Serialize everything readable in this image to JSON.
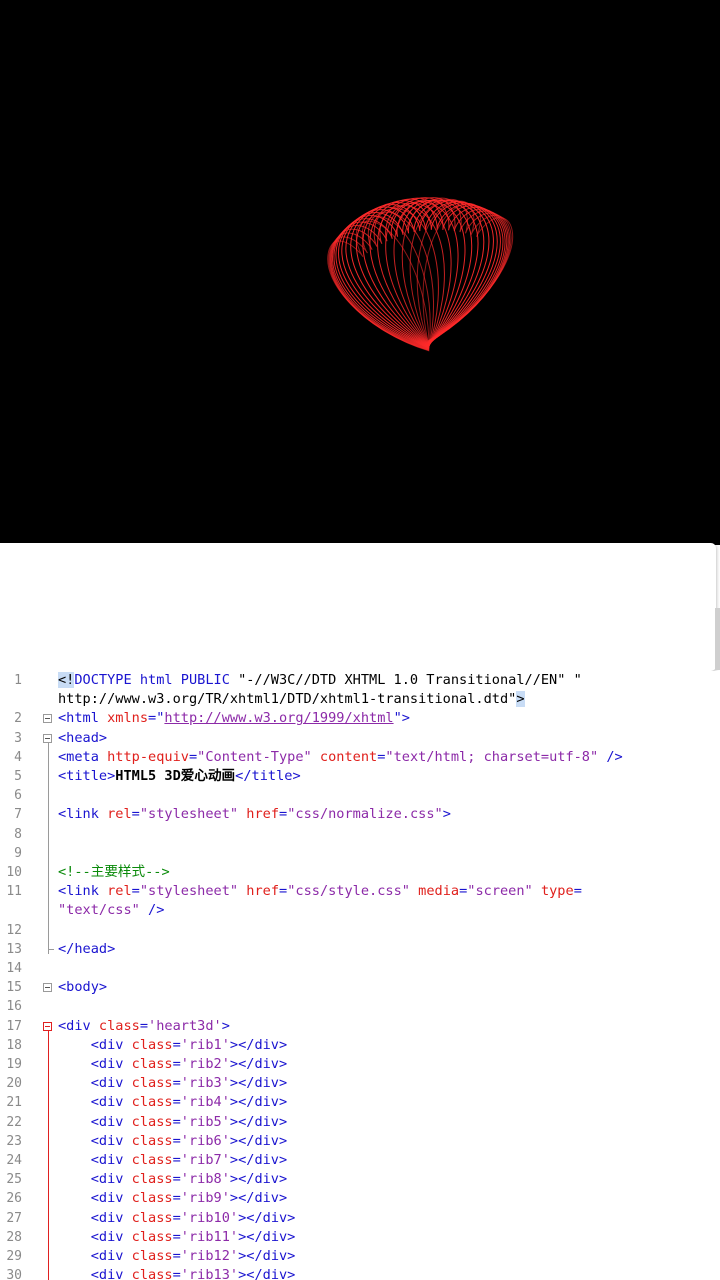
{
  "preview": {
    "heart_color": "#ff2a2a",
    "background": "#000000"
  },
  "editor": {
    "lines": [
      {
        "n": "1",
        "parts": [
          [
            "hl",
            "<!"
          ],
          [
            "tag",
            "DOCTYPE html PUBLIC "
          ],
          [
            "text",
            "\"-//W3C//DTD XHTML 1.0 Transitional//EN\" \""
          ]
        ]
      },
      {
        "n": "",
        "parts": [
          [
            "text",
            "http://www.w3.org/TR/xhtml1/DTD/xhtml1-transitional.dtd\""
          ],
          [
            "hl",
            ">"
          ]
        ]
      },
      {
        "n": "2",
        "parts": [
          [
            "tag",
            "<html "
          ],
          [
            "attr",
            "xmlns"
          ],
          [
            "tag",
            "=\""
          ],
          [
            "link",
            "http://www.w3.org/1999/xhtml"
          ],
          [
            "tag",
            "\">"
          ]
        ]
      },
      {
        "n": "3",
        "parts": [
          [
            "tag",
            "<head>"
          ]
        ]
      },
      {
        "n": "4",
        "parts": [
          [
            "tag",
            "<meta "
          ],
          [
            "attr",
            "http-equiv"
          ],
          [
            "tag",
            "="
          ],
          [
            "val",
            "\"Content-Type\""
          ],
          [
            "tag",
            " "
          ],
          [
            "attr",
            "content"
          ],
          [
            "tag",
            "="
          ],
          [
            "val",
            "\"text/html; charset=utf-8\""
          ],
          [
            "tag",
            " />"
          ]
        ]
      },
      {
        "n": "5",
        "parts": [
          [
            "tag",
            "<title>"
          ],
          [
            "bold",
            "HTML5 3D爱心动画"
          ],
          [
            "tag",
            "</title>"
          ]
        ]
      },
      {
        "n": "6",
        "parts": []
      },
      {
        "n": "7",
        "parts": [
          [
            "tag",
            "<link "
          ],
          [
            "attr",
            "rel"
          ],
          [
            "tag",
            "="
          ],
          [
            "val",
            "\"stylesheet\""
          ],
          [
            "tag",
            " "
          ],
          [
            "attr",
            "href"
          ],
          [
            "tag",
            "="
          ],
          [
            "val",
            "\"css/normalize.css\""
          ],
          [
            "tag",
            ">"
          ]
        ]
      },
      {
        "n": "8",
        "parts": []
      },
      {
        "n": "9",
        "parts": []
      },
      {
        "n": "10",
        "parts": [
          [
            "comment",
            "<!--主要样式-->"
          ]
        ]
      },
      {
        "n": "11",
        "parts": [
          [
            "tag",
            "<link "
          ],
          [
            "attr",
            "rel"
          ],
          [
            "tag",
            "="
          ],
          [
            "val",
            "\"stylesheet\""
          ],
          [
            "tag",
            " "
          ],
          [
            "attr",
            "href"
          ],
          [
            "tag",
            "="
          ],
          [
            "val",
            "\"css/style.css\""
          ],
          [
            "tag",
            " "
          ],
          [
            "attr",
            "media"
          ],
          [
            "tag",
            "="
          ],
          [
            "val",
            "\"screen\""
          ],
          [
            "tag",
            " "
          ],
          [
            "attr",
            "type"
          ],
          [
            "tag",
            "="
          ]
        ]
      },
      {
        "n": "",
        "parts": [
          [
            "val",
            "\"text/css\""
          ],
          [
            "tag",
            " />"
          ]
        ]
      },
      {
        "n": "12",
        "parts": []
      },
      {
        "n": "13",
        "parts": [
          [
            "tag",
            "</head>"
          ]
        ]
      },
      {
        "n": "14",
        "parts": []
      },
      {
        "n": "15",
        "parts": [
          [
            "tag",
            "<body>"
          ]
        ]
      },
      {
        "n": "16",
        "parts": []
      },
      {
        "n": "17",
        "parts": [
          [
            "tag",
            "<div "
          ],
          [
            "attr",
            "class"
          ],
          [
            "tag",
            "="
          ],
          [
            "val",
            "'heart3d'"
          ],
          [
            "tag",
            ">"
          ]
        ]
      },
      {
        "n": "18",
        "parts": [
          [
            "tag",
            "    <div "
          ],
          [
            "attr",
            "class"
          ],
          [
            "tag",
            "="
          ],
          [
            "val",
            "'rib1'"
          ],
          [
            "tag",
            "></div>"
          ]
        ]
      },
      {
        "n": "19",
        "parts": [
          [
            "tag",
            "    <div "
          ],
          [
            "attr",
            "class"
          ],
          [
            "tag",
            "="
          ],
          [
            "val",
            "'rib2'"
          ],
          [
            "tag",
            "></div>"
          ]
        ]
      },
      {
        "n": "20",
        "parts": [
          [
            "tag",
            "    <div "
          ],
          [
            "attr",
            "class"
          ],
          [
            "tag",
            "="
          ],
          [
            "val",
            "'rib3'"
          ],
          [
            "tag",
            "></div>"
          ]
        ]
      },
      {
        "n": "21",
        "parts": [
          [
            "tag",
            "    <div "
          ],
          [
            "attr",
            "class"
          ],
          [
            "tag",
            "="
          ],
          [
            "val",
            "'rib4'"
          ],
          [
            "tag",
            "></div>"
          ]
        ]
      },
      {
        "n": "22",
        "parts": [
          [
            "tag",
            "    <div "
          ],
          [
            "attr",
            "class"
          ],
          [
            "tag",
            "="
          ],
          [
            "val",
            "'rib5'"
          ],
          [
            "tag",
            "></div>"
          ]
        ]
      },
      {
        "n": "23",
        "parts": [
          [
            "tag",
            "    <div "
          ],
          [
            "attr",
            "class"
          ],
          [
            "tag",
            "="
          ],
          [
            "val",
            "'rib6'"
          ],
          [
            "tag",
            "></div>"
          ]
        ]
      },
      {
        "n": "24",
        "parts": [
          [
            "tag",
            "    <div "
          ],
          [
            "attr",
            "class"
          ],
          [
            "tag",
            "="
          ],
          [
            "val",
            "'rib7'"
          ],
          [
            "tag",
            "></div>"
          ]
        ]
      },
      {
        "n": "25",
        "parts": [
          [
            "tag",
            "    <div "
          ],
          [
            "attr",
            "class"
          ],
          [
            "tag",
            "="
          ],
          [
            "val",
            "'rib8'"
          ],
          [
            "tag",
            "></div>"
          ]
        ]
      },
      {
        "n": "26",
        "parts": [
          [
            "tag",
            "    <div "
          ],
          [
            "attr",
            "class"
          ],
          [
            "tag",
            "="
          ],
          [
            "val",
            "'rib9'"
          ],
          [
            "tag",
            "></div>"
          ]
        ]
      },
      {
        "n": "27",
        "parts": [
          [
            "tag",
            "    <div "
          ],
          [
            "attr",
            "class"
          ],
          [
            "tag",
            "="
          ],
          [
            "val",
            "'rib10'"
          ],
          [
            "tag",
            "></div>"
          ]
        ]
      },
      {
        "n": "28",
        "parts": [
          [
            "tag",
            "    <div "
          ],
          [
            "attr",
            "class"
          ],
          [
            "tag",
            "="
          ],
          [
            "val",
            "'rib11'"
          ],
          [
            "tag",
            "></div>"
          ]
        ]
      },
      {
        "n": "29",
        "parts": [
          [
            "tag",
            "    <div "
          ],
          [
            "attr",
            "class"
          ],
          [
            "tag",
            "="
          ],
          [
            "val",
            "'rib12'"
          ],
          [
            "tag",
            "></div>"
          ]
        ]
      },
      {
        "n": "30",
        "parts": [
          [
            "tag",
            "    <div "
          ],
          [
            "attr",
            "class"
          ],
          [
            "tag",
            "="
          ],
          [
            "val",
            "'rib13'"
          ],
          [
            "tag",
            "></div>"
          ]
        ]
      }
    ]
  }
}
